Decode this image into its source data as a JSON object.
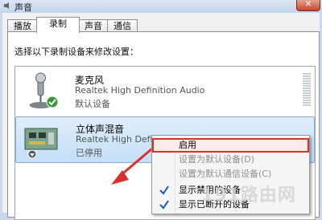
{
  "window": {
    "title": "声音",
    "close_glyph": "✕"
  },
  "tabs": [
    {
      "label": "播放"
    },
    {
      "label": "录制"
    },
    {
      "label": "声音"
    },
    {
      "label": "通信"
    }
  ],
  "instruction": "选择以下录制设备来修改设置：",
  "devices": [
    {
      "name": "麦克风",
      "driver": "Realtek High Definition Audio",
      "status": "默认设备",
      "icon": "microphone-icon",
      "default": true
    },
    {
      "name": "立体声混音",
      "driver": "Realtek High Definition Audio",
      "status": "已停用",
      "icon": "sound-card-icon",
      "disabled": true
    }
  ],
  "context_menu": {
    "items": [
      {
        "label": "启用",
        "enabled": true,
        "highlighted": true
      },
      {
        "label": "设置为默认设备(D)",
        "enabled": false
      },
      {
        "label": "设置为默认通信设备(C)",
        "enabled": false
      },
      {
        "label": "显示禁用的设备",
        "checked": true
      },
      {
        "label": "显示已断开的设备",
        "checked": true
      }
    ]
  },
  "watermark": "191路由网",
  "colors": {
    "annotation": "#d9302b",
    "selection": "#c4dff8"
  }
}
